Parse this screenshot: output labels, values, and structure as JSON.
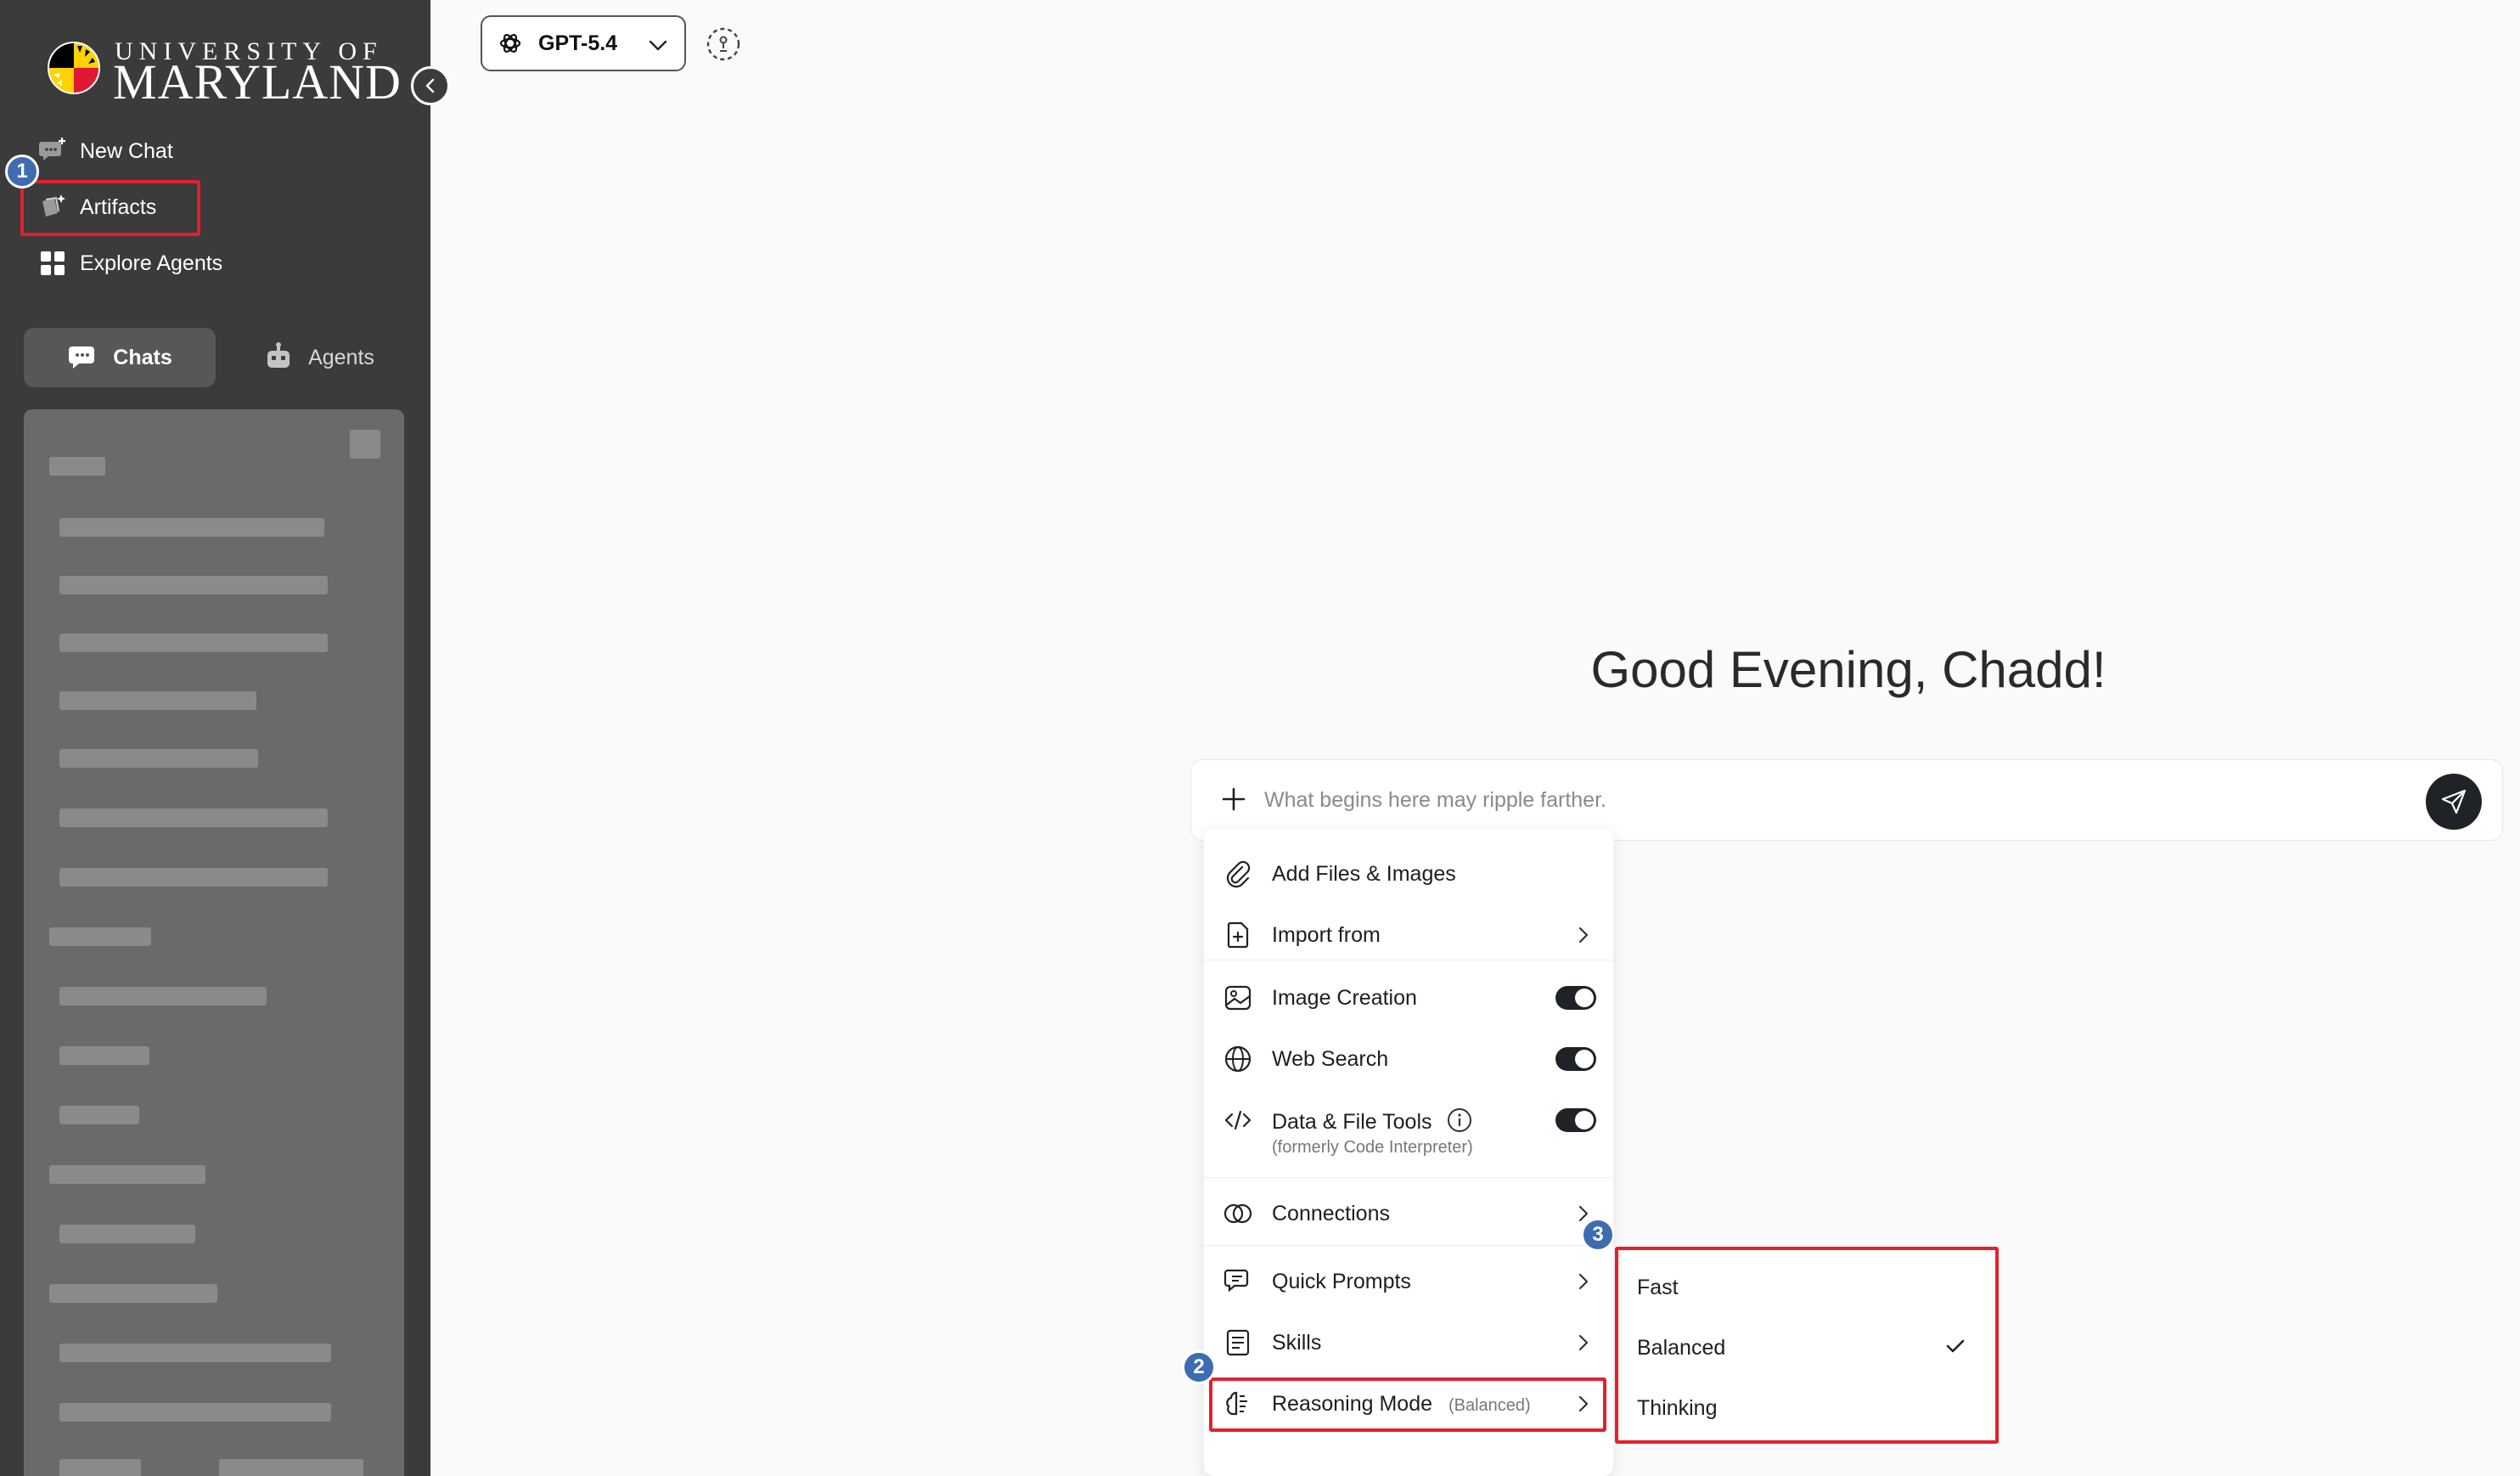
{
  "sidebar": {
    "logo": {
      "line1": "UNIVERSITY OF",
      "line2": "MARYLAND"
    },
    "nav": [
      {
        "label": "New Chat",
        "icon": "new-chat-icon"
      },
      {
        "label": "Artifacts",
        "icon": "artifacts-icon"
      },
      {
        "label": "Explore Agents",
        "icon": "explore-agents-icon"
      }
    ],
    "tabs": [
      {
        "label": "Chats",
        "icon": "chats-icon",
        "active": true
      },
      {
        "label": "Agents",
        "icon": "agents-icon",
        "active": false
      }
    ]
  },
  "header": {
    "model": "GPT-5.4"
  },
  "main": {
    "greeting": "Good Evening, Chadd!",
    "input": {
      "placeholder": "What begins here may ripple farther."
    }
  },
  "tools_menu": {
    "items": [
      {
        "label": "Add Files & Images",
        "icon": "paperclip-icon"
      },
      {
        "label": "Import from",
        "icon": "import-file-icon",
        "submenu": true
      },
      {
        "label": "Image Creation",
        "icon": "image-creation-icon",
        "toggle": true
      },
      {
        "label": "Web Search",
        "icon": "globe-icon",
        "toggle": true
      },
      {
        "label": "Data & File Tools",
        "sublabel": "(formerly Code Interpreter)",
        "icon": "code-icon",
        "toggle": true
      },
      {
        "label": "Connections",
        "icon": "connections-icon",
        "submenu": true
      },
      {
        "label": "Quick Prompts",
        "icon": "quick-prompts-icon",
        "submenu": true
      },
      {
        "label": "Skills",
        "icon": "skills-icon",
        "submenu": true
      },
      {
        "label": "Reasoning Mode",
        "sublabel": "(Balanced)",
        "icon": "brain-icon",
        "submenu": true
      }
    ]
  },
  "reasoning_submenu": {
    "options": [
      "Fast",
      "Balanced",
      "Thinking"
    ],
    "selected": "Balanced"
  },
  "annotations": {
    "badges": [
      "1",
      "2",
      "3"
    ]
  },
  "colors": {
    "sidebar_bg": "#3b3b3b",
    "highlight_red": "#e3202c",
    "badge_blue": "#3d6db0",
    "send_button": "#1f2328"
  }
}
